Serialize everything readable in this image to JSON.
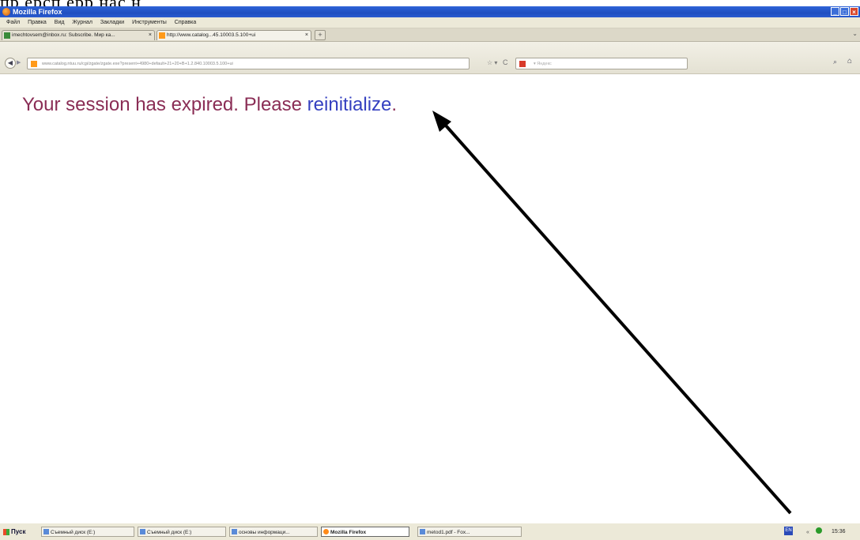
{
  "doc_text": "пр ерсп ерр нас н ",
  "window": {
    "title": "Mozilla Firefox",
    "minimize": "_",
    "maximize": "□",
    "close": "×"
  },
  "menu": [
    "Файл",
    "Правка",
    "Вид",
    "Журнал",
    "Закладки",
    "Инструменты",
    "Справка"
  ],
  "tabs": [
    {
      "label": "imechtovsem@inbox.ru: Subscribe. Мир ка...",
      "close": "×",
      "active": false,
      "icon": "mail-icon"
    },
    {
      "label": "http://www.catalog...45.10003.5.100+ui",
      "close": "×",
      "active": true,
      "icon": "site-icon"
    }
  ],
  "new_tab": "+",
  "tab_list": "⌄",
  "nav": {
    "back": "◀",
    "forward": "▶",
    "url": "www.catalog.ntuu.ru/cgi/zgate/zgate.exe?present+4980+default+21+20+B+1.2.840.10003.5.100+ui",
    "bookmark_star": "☆ ▾",
    "reload": "C",
    "search_placeholder": "▾ Яндекс",
    "search_go": "⌕",
    "home": "⌂"
  },
  "page": {
    "message": "Your session has expired. Please ",
    "link": "reinitialize",
    "period": "."
  },
  "taskbar": {
    "start": "Пуск",
    "tasks": [
      {
        "label": "Съемный диск (E:)",
        "active": false
      },
      {
        "label": "Съемный диск (E:)",
        "active": false
      },
      {
        "label": "основы информаци...",
        "active": false
      },
      {
        "label": "Mozilla Firefox",
        "active": true
      },
      {
        "label": "metod1.pdf - Fox...",
        "active": false
      }
    ],
    "lang": "EN",
    "network": "«",
    "clock": "15:36"
  },
  "colors": {
    "message": "#8a2d55",
    "link": "#3540c0",
    "titlebar": "#1f4fc0"
  }
}
